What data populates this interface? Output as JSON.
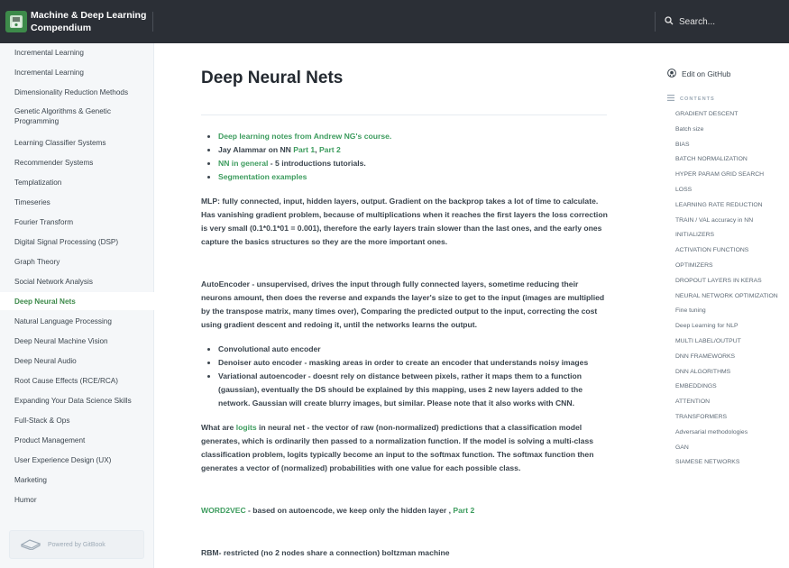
{
  "header": {
    "title": "Machine & Deep Learning Compendium",
    "search_placeholder": "Search..."
  },
  "sidebar": {
    "items": [
      {
        "label": "Incremental Learning"
      },
      {
        "label": "Incremental Learning"
      },
      {
        "label": "Dimensionality Reduction Methods"
      },
      {
        "label": "Genetic Algorithms & Genetic Programming"
      },
      {
        "label": "Learning Classifier Systems"
      },
      {
        "label": "Recommender Systems"
      },
      {
        "label": "Templatization"
      },
      {
        "label": "Timeseries"
      },
      {
        "label": "Fourier Transform"
      },
      {
        "label": "Digital Signal Processing (DSP)"
      },
      {
        "label": "Graph Theory"
      },
      {
        "label": "Social Network Analysis"
      },
      {
        "label": "Deep Neural Nets",
        "active": true
      },
      {
        "label": "Natural Language Processing"
      },
      {
        "label": "Deep Neural Machine Vision"
      },
      {
        "label": "Deep Neural Audio"
      },
      {
        "label": "Root Cause Effects (RCE/RCA)"
      },
      {
        "label": "Expanding Your Data Science Skills"
      },
      {
        "label": "Full-Stack & Ops"
      },
      {
        "label": "Product Management"
      },
      {
        "label": "User Experience Design (UX)"
      },
      {
        "label": "Marketing"
      },
      {
        "label": "Humor"
      }
    ],
    "powered_by": "Powered by GitBook"
  },
  "main": {
    "title": "Deep Neural Nets",
    "bullets1": {
      "b1_link": "Deep learning notes from Andrew NG's course.",
      "b2_text": "Jay Alammar on NN ",
      "b2_link1": "Part 1",
      "b2_sep": ", ",
      "b2_link2": "Part 2",
      "b3_link": "NN in general",
      "b3_text": " - 5 introductions  tutorials.",
      "b4_link": "Segmentation examples"
    },
    "mlp": "MLP: fully connected, input, hidden layers, output. Gradient on the backprop takes a lot of time to calculate. Has vanishing gradient problem, because of multiplications when it reaches the first layers the loss correction is very small (0.1*0.1*01 = 0.001), therefore the early layers train slower than the last ones, and the early ones capture the basics structures so they are the more important ones.",
    "autoencoder": "AutoEncoder - unsupervised, drives the input through fully connected layers, sometime reducing their neurons amount, then does the reverse and expands the layer's size to get to the input (images are multiplied by the transpose matrix, many times over), Comparing the predicted output to the input, correcting the cost using gradient descent and redoing it, until the networks learns the output.",
    "bullets2": [
      "Convolutional auto encoder",
      "Denoiser auto encoder - masking areas in order to create an encoder that understands noisy images",
      "Variational autoencoder - doesnt rely on distance between pixels, rather it maps them to a function (gaussian), eventually the DS should be explained by this mapping, uses 2 new layers added to the network. Gaussian will create blurry images, but similar. Please note that it also works with CNN."
    ],
    "logits_pre": "What are ",
    "logits_link": "logits",
    "logits_post": " in neural net - the vector of raw (non-normalized) predictions that a classification model generates, which is ordinarily then passed to a normalization function. If the model is solving a multi-class classification problem, logits typically become an input to the softmax function. The softmax function then generates a vector of (normalized) probabilities with one value for each possible class.",
    "w2v_link": "WORD2VEC",
    "w2v_text": " - based on autoencode, we keep only the hidden layer , ",
    "w2v_link2": "Part 2",
    "rbm": "RBM- restricted (no 2 nodes share a connection) boltzman machine"
  },
  "right": {
    "edit_label": "Edit on GitHub",
    "contents_label": "CONTENTS",
    "toc": [
      "GRADIENT DESCENT",
      "Batch size",
      "BIAS",
      "BATCH NORMALIZATION",
      "HYPER PARAM GRID SEARCH",
      "LOSS",
      "LEARNING RATE REDUCTION",
      "TRAIN / VAL accuracy in NN",
      "INITIALIZERS",
      "ACTIVATION FUNCTIONS",
      "OPTIMIZERS",
      "DROPOUT LAYERS IN KERAS",
      "NEURAL NETWORK OPTIMIZATION",
      "Fine tuning",
      "Deep Learning for NLP",
      "MULTI LABEL/OUTPUT",
      "DNN FRAMEWORKS",
      "DNN ALGORITHMS",
      "EMBEDDINGS",
      "ATTENTION",
      "TRANSFORMERS",
      "Adversarial methodologies",
      "GAN",
      "SIAMESE NETWORKS"
    ]
  },
  "colors": {
    "header_bg": "#2b2f36",
    "accent_green": "#3d8a4a",
    "link_green": "#3d9c5e",
    "sidebar_bg": "#f5f7f9"
  }
}
